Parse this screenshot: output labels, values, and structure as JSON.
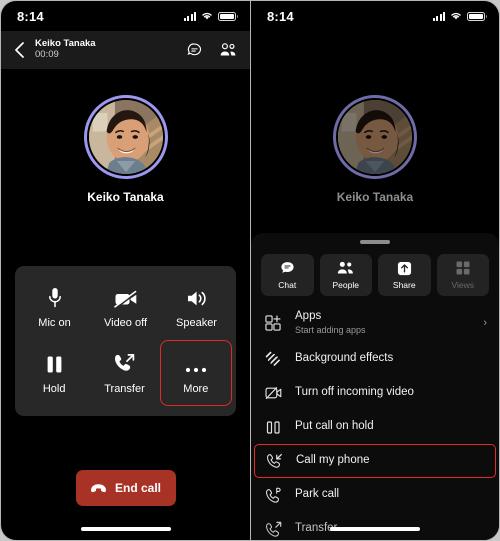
{
  "status_bar": {
    "time": "8:14",
    "signal_icon": "cellular-signal-icon",
    "wifi_icon": "wifi-icon",
    "battery_icon": "battery-icon"
  },
  "left_phone": {
    "header": {
      "back_icon": "back-chevron-icon",
      "contact_name": "Keiko Tanaka",
      "call_duration": "00:09",
      "chat_icon": "chat-bubble-icon",
      "people_icon": "people-icon"
    },
    "participant": {
      "name": "Keiko Tanaka",
      "avatar_ring_color": "#9c97f0"
    },
    "controls": [
      {
        "label": "Mic on",
        "icon": "microphone-icon",
        "highlighted": false
      },
      {
        "label": "Video off",
        "icon": "video-off-icon",
        "highlighted": false
      },
      {
        "label": "Speaker",
        "icon": "speaker-icon",
        "highlighted": false
      },
      {
        "label": "Hold",
        "icon": "pause-icon",
        "highlighted": false
      },
      {
        "label": "Transfer",
        "icon": "call-transfer-icon",
        "highlighted": false
      },
      {
        "label": "More",
        "icon": "more-dots-icon",
        "highlighted": true
      }
    ],
    "end_call": {
      "label": "End call",
      "icon": "end-call-handset-icon",
      "color": "#a93226"
    }
  },
  "right_phone": {
    "participant": {
      "name": "Keiko Tanaka",
      "avatar_ring_color": "#6f6ba8"
    },
    "sheet": {
      "grabber": "drag-handle",
      "quick_actions": [
        {
          "label": "Chat",
          "icon": "chat-bubble-icon",
          "disabled": false
        },
        {
          "label": "People",
          "icon": "people-icon",
          "disabled": false
        },
        {
          "label": "Share",
          "icon": "share-upload-icon",
          "disabled": false
        },
        {
          "label": "Views",
          "icon": "grid-views-icon",
          "disabled": true
        }
      ],
      "menu_items": [
        {
          "title": "Apps",
          "subtitle": "Start adding apps",
          "icon": "apps-grid-icon",
          "chevron": "›",
          "highlighted": false
        },
        {
          "title": "Background effects",
          "subtitle": "",
          "icon": "background-effects-icon",
          "chevron": "",
          "highlighted": false
        },
        {
          "title": "Turn off incoming video",
          "subtitle": "",
          "icon": "video-off-box-icon",
          "chevron": "",
          "highlighted": false
        },
        {
          "title": "Put call on hold",
          "subtitle": "",
          "icon": "pause-icon",
          "chevron": "",
          "highlighted": false
        },
        {
          "title": "Call my phone",
          "subtitle": "",
          "icon": "call-inbound-icon",
          "chevron": "",
          "highlighted": true
        },
        {
          "title": "Park call",
          "subtitle": "",
          "icon": "call-park-icon",
          "chevron": "",
          "highlighted": false
        },
        {
          "title": "Transfer",
          "subtitle": "",
          "icon": "call-transfer-icon",
          "chevron": "",
          "highlighted": false
        }
      ]
    }
  }
}
